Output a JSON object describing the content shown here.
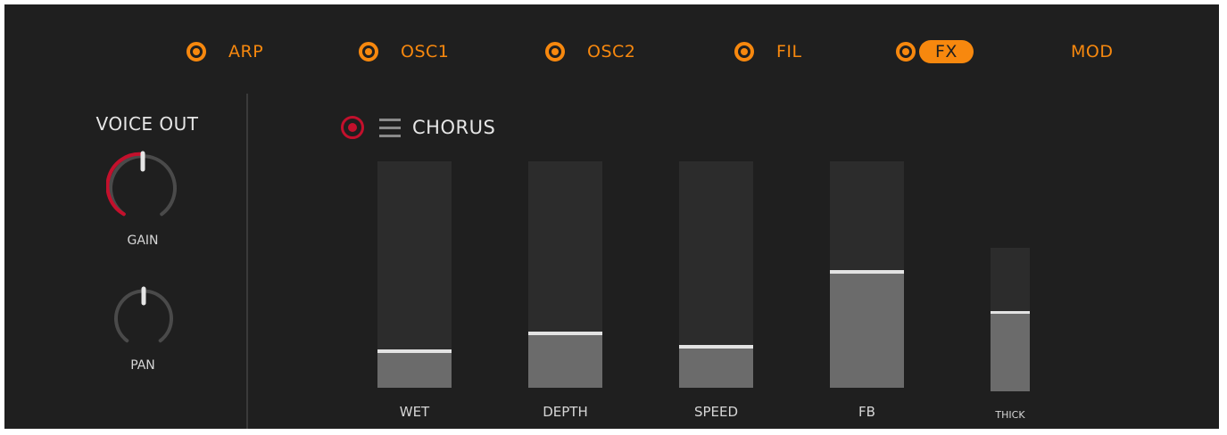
{
  "nav": {
    "tabs": [
      {
        "label": "ARP",
        "active": false,
        "has_led": true
      },
      {
        "label": "OSC1",
        "active": false,
        "has_led": true
      },
      {
        "label": "OSC2",
        "active": false,
        "has_led": true
      },
      {
        "label": "FIL",
        "active": false,
        "has_led": true
      },
      {
        "label": "FX",
        "active": true,
        "has_led": true
      },
      {
        "label": "MOD",
        "active": false,
        "has_led": false
      }
    ]
  },
  "voice_out": {
    "title": "VOICE OUT",
    "gain": {
      "label": "GAIN",
      "value": 0.5
    },
    "pan": {
      "label": "PAN",
      "value": 0.5
    }
  },
  "chorus": {
    "title": "CHORUS",
    "enabled": true,
    "sliders": [
      {
        "label": "WET",
        "value": 0.16
      },
      {
        "label": "DEPTH",
        "value": 0.24
      },
      {
        "label": "SPEED",
        "value": 0.18
      },
      {
        "label": "FB",
        "value": 0.51
      },
      {
        "label": "THICK",
        "value": 0.55
      }
    ]
  },
  "colors": {
    "accent": "#f7880e",
    "power": "#c3102c",
    "panel": "#1f1f1f",
    "track": "#2c2c2c",
    "fill": "#6b6b6b"
  }
}
